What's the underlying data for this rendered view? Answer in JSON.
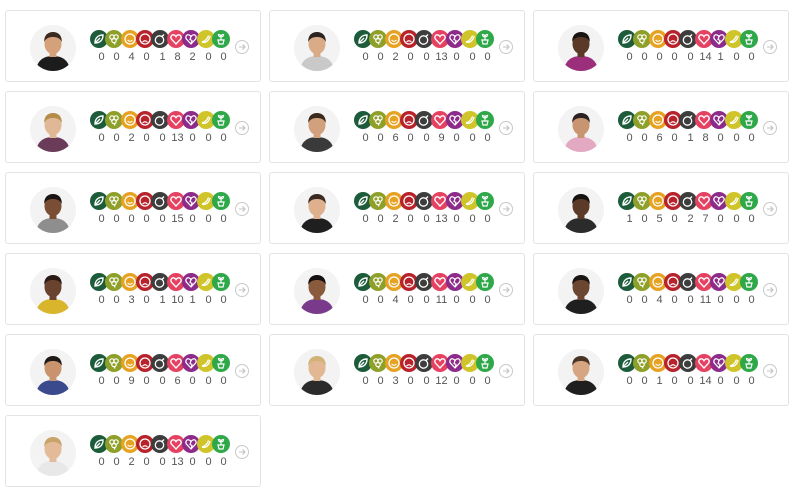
{
  "icon_set": [
    {
      "name": "leaf-icon",
      "color": "#1d5c3b"
    },
    {
      "name": "clover-icon",
      "color": "#8ea02a"
    },
    {
      "name": "smile-icon",
      "color": "#e6a223"
    },
    {
      "name": "sad-icon",
      "color": "#b8222a"
    },
    {
      "name": "bomb-icon",
      "color": "#3d3d3d"
    },
    {
      "name": "heart-icon",
      "color": "#e54262"
    },
    {
      "name": "broken-heart-icon",
      "color": "#8c2b8a"
    },
    {
      "name": "banana-icon",
      "color": "#cfc52b"
    },
    {
      "name": "potted-plant-icon",
      "color": "#2fa84a"
    }
  ],
  "participants": [
    {
      "counts": [
        "0",
        "0",
        "4",
        "0",
        "1",
        "8",
        "2",
        "0",
        "0"
      ],
      "avatar": {
        "skin": "#d4a17a",
        "hair": "#3a2a20",
        "shirt": "#1c1c1c"
      }
    },
    {
      "counts": [
        "0",
        "0",
        "2",
        "0",
        "0",
        "13",
        "0",
        "0",
        "0"
      ],
      "avatar": {
        "skin": "#d9ab86",
        "hair": "#2b2420",
        "shirt": "#c9c9c9"
      }
    },
    {
      "counts": [
        "0",
        "0",
        "0",
        "0",
        "0",
        "14",
        "1",
        "0",
        "0"
      ],
      "avatar": {
        "skin": "#5a3a26",
        "hair": "#1a1412",
        "shirt": "#9c2f7c"
      }
    },
    {
      "counts": [
        "0",
        "0",
        "2",
        "0",
        "0",
        "13",
        "0",
        "0",
        "0"
      ],
      "avatar": {
        "skin": "#e0b896",
        "hair": "#b58b4a",
        "shirt": "#6b3b5a"
      }
    },
    {
      "counts": [
        "0",
        "0",
        "6",
        "0",
        "0",
        "9",
        "0",
        "0",
        "0"
      ],
      "avatar": {
        "skin": "#d2a07c",
        "hair": "#3a2a1c",
        "shirt": "#3a3a3a"
      }
    },
    {
      "counts": [
        "0",
        "0",
        "6",
        "0",
        "1",
        "8",
        "0",
        "0",
        "0"
      ],
      "avatar": {
        "skin": "#c89570",
        "hair": "#2a2220",
        "shirt": "#e3a8c2"
      }
    },
    {
      "counts": [
        "0",
        "0",
        "0",
        "0",
        "0",
        "15",
        "0",
        "0",
        "0"
      ],
      "avatar": {
        "skin": "#7a4e35",
        "hair": "#1a1412",
        "shirt": "#8e8e8e"
      }
    },
    {
      "counts": [
        "0",
        "0",
        "2",
        "0",
        "0",
        "13",
        "0",
        "0",
        "0"
      ],
      "avatar": {
        "skin": "#dfb08e",
        "hair": "#3b2a22",
        "shirt": "#1f1f1f"
      }
    },
    {
      "counts": [
        "1",
        "0",
        "5",
        "0",
        "2",
        "7",
        "0",
        "0",
        "0"
      ],
      "avatar": {
        "skin": "#5b3a28",
        "hair": "#161210",
        "shirt": "#2b2b2b"
      }
    },
    {
      "counts": [
        "0",
        "0",
        "3",
        "0",
        "1",
        "10",
        "1",
        "0",
        "0"
      ],
      "avatar": {
        "skin": "#6a432e",
        "hair": "#2a1a14",
        "shirt": "#d8b52a"
      }
    },
    {
      "counts": [
        "0",
        "0",
        "4",
        "0",
        "0",
        "11",
        "0",
        "0",
        "0"
      ],
      "avatar": {
        "skin": "#8a5a3c",
        "hair": "#141010",
        "shirt": "#7a3a8c"
      }
    },
    {
      "counts": [
        "0",
        "0",
        "4",
        "0",
        "0",
        "11",
        "0",
        "0",
        "0"
      ],
      "avatar": {
        "skin": "#6b4630",
        "hair": "#1a1412",
        "shirt": "#1f1f1f"
      }
    },
    {
      "counts": [
        "0",
        "0",
        "9",
        "0",
        "0",
        "6",
        "0",
        "0",
        "0"
      ],
      "avatar": {
        "skin": "#c9936d",
        "hair": "#1f1a18",
        "shirt": "#3b4a8c"
      }
    },
    {
      "counts": [
        "0",
        "0",
        "3",
        "0",
        "0",
        "12",
        "0",
        "0",
        "0"
      ],
      "avatar": {
        "skin": "#e2b894",
        "hair": "#d2b276",
        "shirt": "#2b2b2b"
      }
    },
    {
      "counts": [
        "0",
        "0",
        "1",
        "0",
        "0",
        "14",
        "0",
        "0",
        "0"
      ],
      "avatar": {
        "skin": "#d6a682",
        "hair": "#4a3426",
        "shirt": "#1f1f1f"
      }
    },
    {
      "counts": [
        "0",
        "0",
        "2",
        "0",
        "0",
        "13",
        "0",
        "0",
        "0"
      ],
      "avatar": {
        "skin": "#e4bb98",
        "hair": "#c9a46a",
        "shirt": "#e8e8e8"
      }
    }
  ]
}
